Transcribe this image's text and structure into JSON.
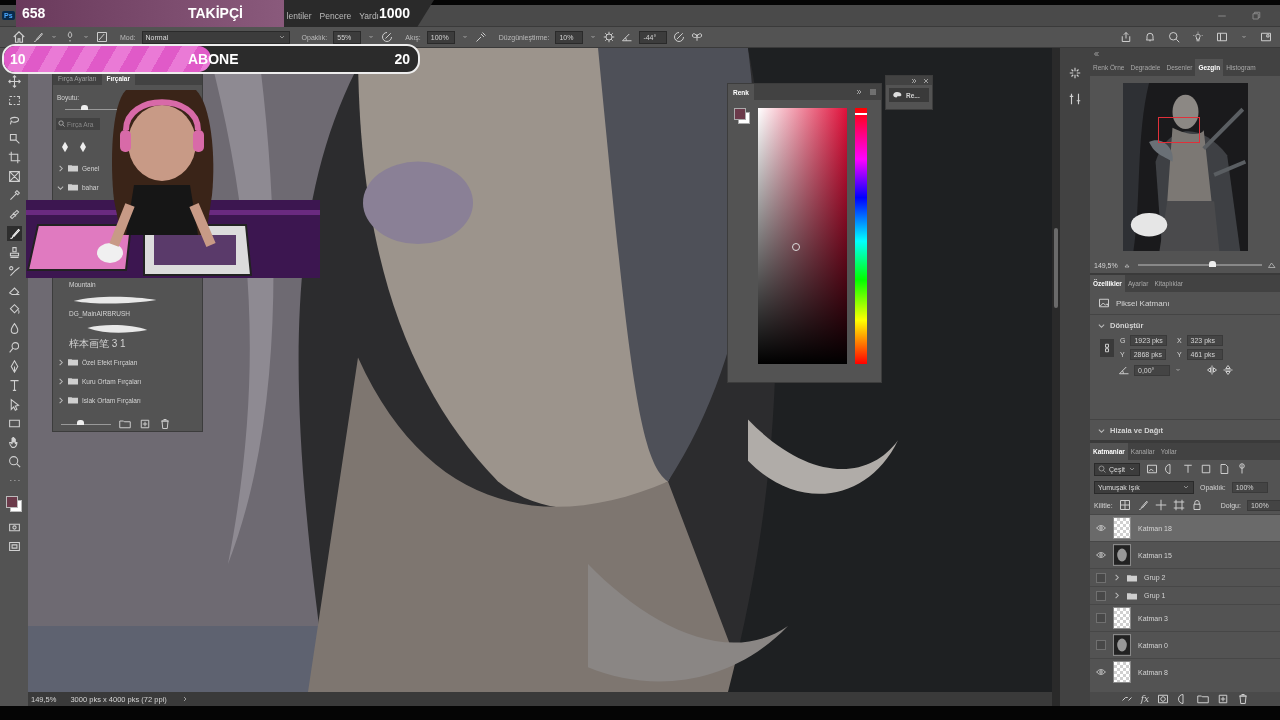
{
  "stream_overlay": {
    "followers": {
      "count": "658",
      "label": "TAKİPÇİ",
      "goal": "1000",
      "level": 0.64
    },
    "subscribers": {
      "count": "10",
      "label": "ABONE",
      "goal": "20",
      "level": 0.5
    }
  },
  "menu_bar": {
    "logo": "Ps",
    "items": [
      "lentiler",
      "Pencere",
      "Yardı"
    ]
  },
  "options_bar": {
    "mode_label": "Mod:",
    "mode": "Normal",
    "opacity_label": "Opaklık:",
    "opacity": "55%",
    "flow_label": "Akış:",
    "flow": "100%",
    "smoothing_label": "Düzgünleştirme:",
    "smoothing": "10%",
    "angle": "-44°"
  },
  "toolbar": {
    "tools": [
      {
        "kind": "move",
        "selected": false
      },
      {
        "kind": "marquee",
        "selected": false
      },
      {
        "kind": "lasso",
        "selected": false
      },
      {
        "kind": "object",
        "selected": false
      },
      {
        "kind": "crop",
        "selected": false
      },
      {
        "kind": "frame",
        "selected": false
      },
      {
        "kind": "eyedropper",
        "selected": false
      },
      {
        "kind": "healing",
        "selected": false
      },
      {
        "kind": "brush",
        "selected": true
      },
      {
        "kind": "stamp",
        "selected": false
      },
      {
        "kind": "history",
        "selected": false
      },
      {
        "kind": "eraser",
        "selected": false
      },
      {
        "kind": "bucket",
        "selected": false
      },
      {
        "kind": "blur",
        "selected": false
      },
      {
        "kind": "dodge",
        "selected": false
      },
      {
        "kind": "pen",
        "selected": false
      },
      {
        "kind": "type",
        "selected": false
      },
      {
        "kind": "path",
        "selected": false
      },
      {
        "kind": "shape",
        "selected": false
      },
      {
        "kind": "hand",
        "selected": false
      },
      {
        "kind": "zoom",
        "selected": false
      },
      {
        "kind": "more",
        "selected": false
      }
    ]
  },
  "brushes_panel": {
    "tabs": [
      {
        "label": "Fırça Ayarları",
        "selected": false
      },
      {
        "label": "Fırçalar",
        "selected": true
      }
    ],
    "size_label": "Boyutu:",
    "search_placeholder": "Fırça Ara",
    "top_folders": [
      {
        "name": "Genel",
        "expanded": false
      },
      {
        "name": "bahar",
        "expanded": true
      }
    ],
    "brushes": [
      {
        "name": "Mountain"
      },
      {
        "name": "DG_MainAIRBRUSH"
      },
      {
        "name": "梓本画笔 3 1"
      }
    ],
    "folders": [
      {
        "name": "Özel Efekt Fırçaları",
        "expanded": false
      },
      {
        "name": "Kuru Ortam Fırçaları",
        "expanded": false
      },
      {
        "name": "Islak Ortam Fırçaları",
        "expanded": false
      }
    ]
  },
  "color_panel": {
    "tab": "Renk",
    "foreground": {
      "color": "#6b3a4a"
    },
    "hue": {
      "level": 0.02
    }
  },
  "mini_panel": {
    "button": "Re..."
  },
  "navigator": {
    "tabs": [
      {
        "label": "Renk Örne",
        "selected": false
      },
      {
        "label": "Degradele",
        "selected": false
      },
      {
        "label": "Desenler",
        "selected": false
      },
      {
        "label": "Gezgin",
        "selected": true
      },
      {
        "label": "Histogram",
        "selected": false
      }
    ],
    "zoom": "149,5%",
    "level": 0.6
  },
  "properties": {
    "tabs": [
      {
        "label": "Özellikler",
        "selected": true
      },
      {
        "label": "Ayarlar",
        "selected": false
      },
      {
        "label": "Kitaplıklar",
        "selected": false
      }
    ],
    "layer_type": "Piksel Katmanı",
    "transform": {
      "title": "Dönüştür",
      "expanded": true,
      "fields": [
        {
          "label": "G",
          "value": "1923 pks"
        },
        {
          "label": "X",
          "value": "323 pks"
        },
        {
          "label": "Y",
          "value": "2868 pks"
        },
        {
          "label": "Y",
          "value": "461 pks"
        }
      ],
      "angle": "0,00°"
    },
    "align": {
      "title": "Hizala ve Dağıt",
      "expanded": true
    }
  },
  "layers": {
    "tabs": [
      {
        "label": "Katmanlar",
        "selected": true
      },
      {
        "label": "Kanallar",
        "selected": false
      },
      {
        "label": "Yollar",
        "selected": false
      }
    ],
    "filter": "Çeşit",
    "blend_mode": "Yumuşak Işık",
    "opacity_label": "Opaklık:",
    "opacity": "100%",
    "lock_label": "Kilitle:",
    "fill_label": "Dolgu:",
    "fill": "100%",
    "fx": "fx",
    "items": [
      {
        "kind": "layer",
        "name": "Katman 18",
        "visible": true,
        "selected": true,
        "thumbnail": {
          "kind": "checker"
        }
      },
      {
        "kind": "layer",
        "name": "Katman 15",
        "visible": true,
        "selected": false,
        "thumbnail": {
          "kind": "artwork"
        }
      },
      {
        "kind": "group",
        "name": "Grup 2",
        "visible": false,
        "selected": false,
        "expanded": false
      },
      {
        "kind": "group",
        "name": "Grup 1",
        "visible": false,
        "selected": false,
        "expanded": false
      },
      {
        "kind": "layer",
        "name": "Katman 3",
        "visible": false,
        "selected": false,
        "thumbnail": {
          "kind": "checker"
        }
      },
      {
        "kind": "layer",
        "name": "Katman 0",
        "visible": false,
        "selected": false,
        "thumbnail": {
          "kind": "artwork"
        }
      },
      {
        "kind": "layer",
        "name": "Katman 8",
        "visible": true,
        "selected": false,
        "thumbnail": {
          "kind": "checker"
        }
      }
    ]
  },
  "status_bar": {
    "zoom": "149,5%",
    "document": "3000 pks x 4000 pks (72 ppi)"
  }
}
